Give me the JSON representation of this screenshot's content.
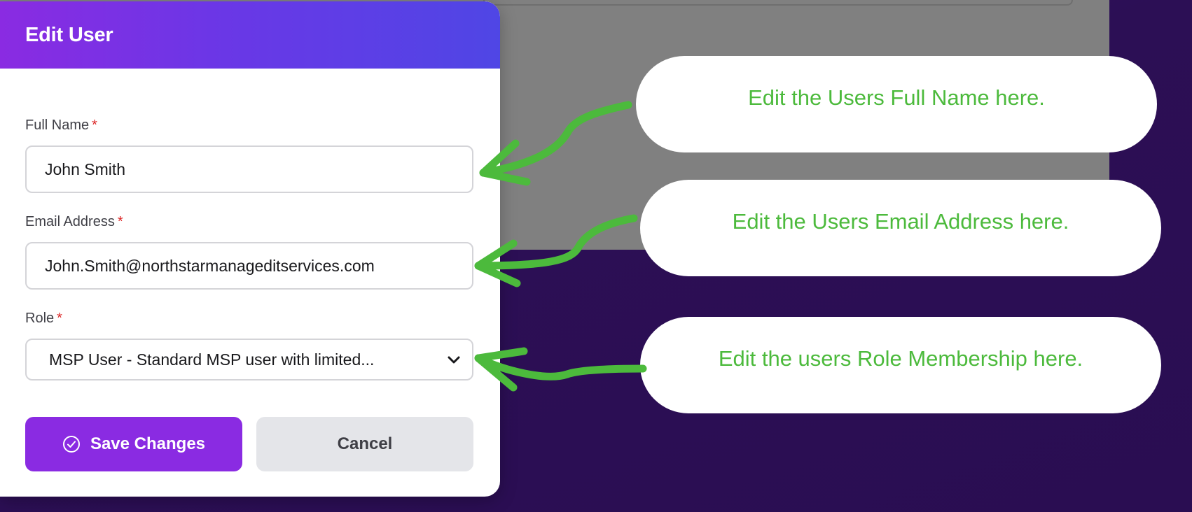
{
  "modal": {
    "title": "Edit User",
    "full_name": {
      "label": "Full Name",
      "required_mark": "*",
      "value": "John Smith"
    },
    "email": {
      "label": "Email Address",
      "required_mark": "*",
      "value": "John.Smith@northstarmanageditservices.com"
    },
    "role": {
      "label": "Role",
      "required_mark": "*",
      "selected": "MSP User - Standard MSP user with limited..."
    },
    "save_label": "Save Changes",
    "cancel_label": "Cancel"
  },
  "callouts": {
    "full_name": "Edit the Users Full Name here.",
    "email": "Edit the Users Email Address here.",
    "role": "Edit the users Role Membership here."
  },
  "colors": {
    "header_gradient_start": "#8a2be2",
    "header_gradient_end": "#4f46e5",
    "save_button": "#8a2be2",
    "callout_text": "#4cba3c",
    "arrow": "#4cba3c",
    "required": "#dc2626"
  },
  "icons": {
    "save": "check-circle-icon",
    "select": "chevron-down-icon"
  }
}
